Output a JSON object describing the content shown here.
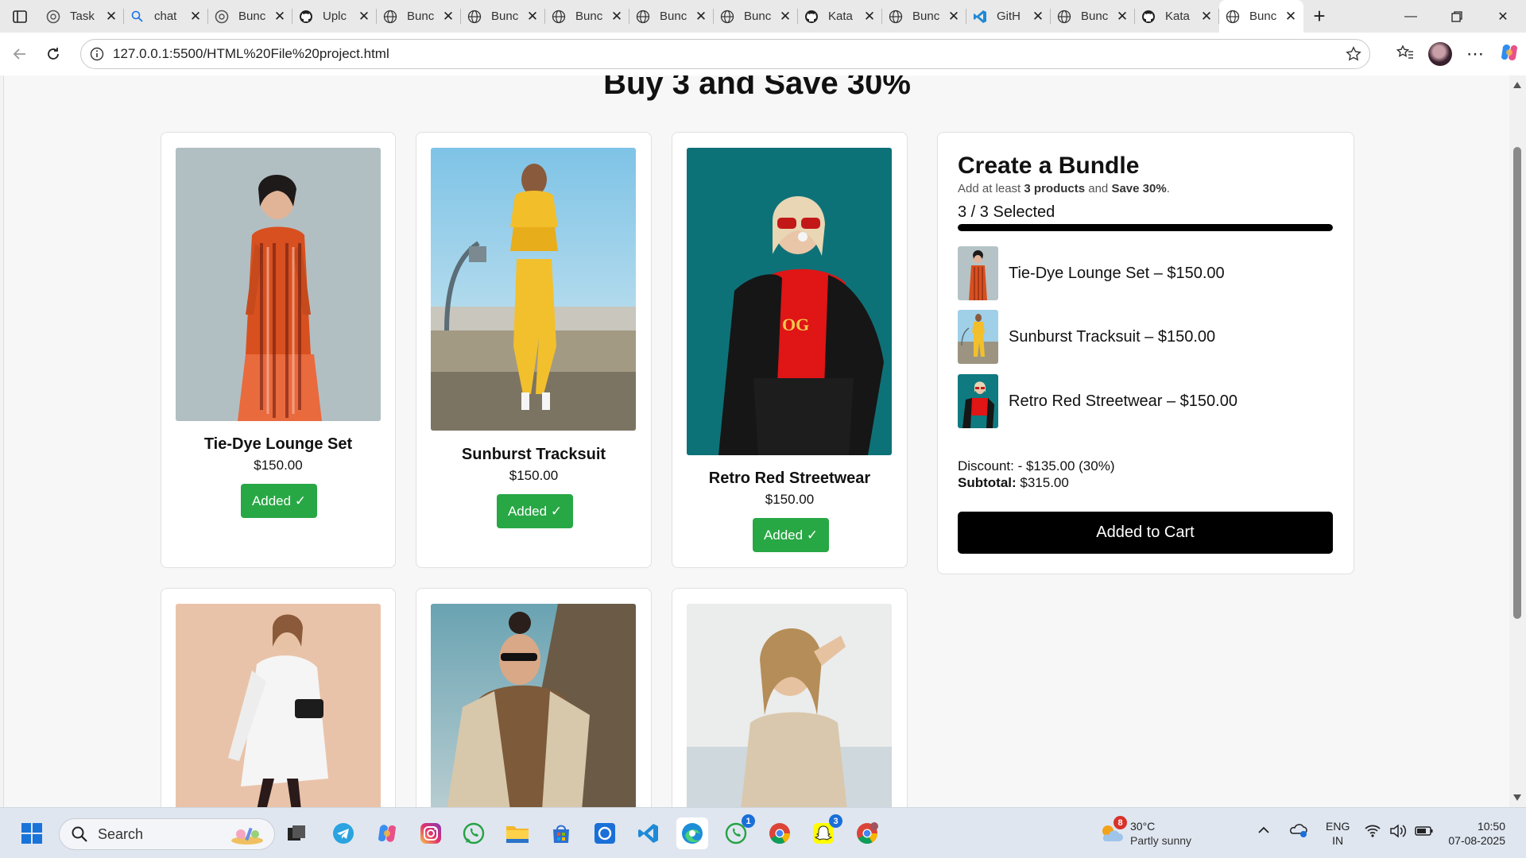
{
  "browser": {
    "tabs": [
      {
        "title": "Task",
        "icon": "openai-icon"
      },
      {
        "title": "chat",
        "icon": "search-icon"
      },
      {
        "title": "Bunc",
        "icon": "openai-icon"
      },
      {
        "title": "Uplc",
        "icon": "github-icon"
      },
      {
        "title": "Bunc",
        "icon": "globe-icon"
      },
      {
        "title": "Bunc",
        "icon": "globe-icon"
      },
      {
        "title": "Bunc",
        "icon": "globe-icon"
      },
      {
        "title": "Bunc",
        "icon": "globe-icon"
      },
      {
        "title": "Bunc",
        "icon": "globe-icon"
      },
      {
        "title": "Kata",
        "icon": "github-icon"
      },
      {
        "title": "Bunc",
        "icon": "globe-icon"
      },
      {
        "title": "GitH",
        "icon": "vscode-icon"
      },
      {
        "title": "Bunc",
        "icon": "globe-icon"
      },
      {
        "title": "Kata",
        "icon": "github-icon"
      },
      {
        "title": "Bunc",
        "icon": "globe-icon",
        "active": true
      }
    ],
    "url": "127.0.0.1:5500/HTML%20File%20project.html"
  },
  "page": {
    "title": "Buy 3 and Save 30%",
    "products": [
      {
        "name": "Tie-Dye Lounge Set",
        "price": "$150.00",
        "button": "Added ✓"
      },
      {
        "name": "Sunburst Tracksuit",
        "price": "$150.00",
        "button": "Added ✓"
      },
      {
        "name": "Retro Red Streetwear",
        "price": "$150.00",
        "button": "Added ✓"
      }
    ]
  },
  "bundle": {
    "title": "Create a Bundle",
    "subtitle_prefix": "Add at least ",
    "subtitle_bold1": "3 products",
    "subtitle_mid": " and ",
    "subtitle_bold2": "Save 30%",
    "subtitle_suffix": ".",
    "count_text": "3 / 3 Selected",
    "progress": 1.0,
    "items": [
      {
        "label": "Tie-Dye Lounge Set – $150.00"
      },
      {
        "label": "Sunburst Tracksuit – $150.00"
      },
      {
        "label": "Retro Red Streetwear – $150.00"
      }
    ],
    "discount_text": "Discount: - $135.00 (30%)",
    "subtotal_label": "Subtotal:",
    "subtotal_value": "$315.00",
    "cart_button": "Added to Cart"
  },
  "taskbar": {
    "search_placeholder": "Search",
    "weather_temp": "30°C",
    "weather_cond": "Partly sunny",
    "weather_badge": "8",
    "whatsapp_badge": "1",
    "snapchat_badge": "3",
    "lang_top": "ENG",
    "lang_bottom": "IN",
    "time": "10:50",
    "date": "07-08-2025"
  },
  "colors": {
    "added_green": "#28a745",
    "cart_black": "#000000"
  }
}
